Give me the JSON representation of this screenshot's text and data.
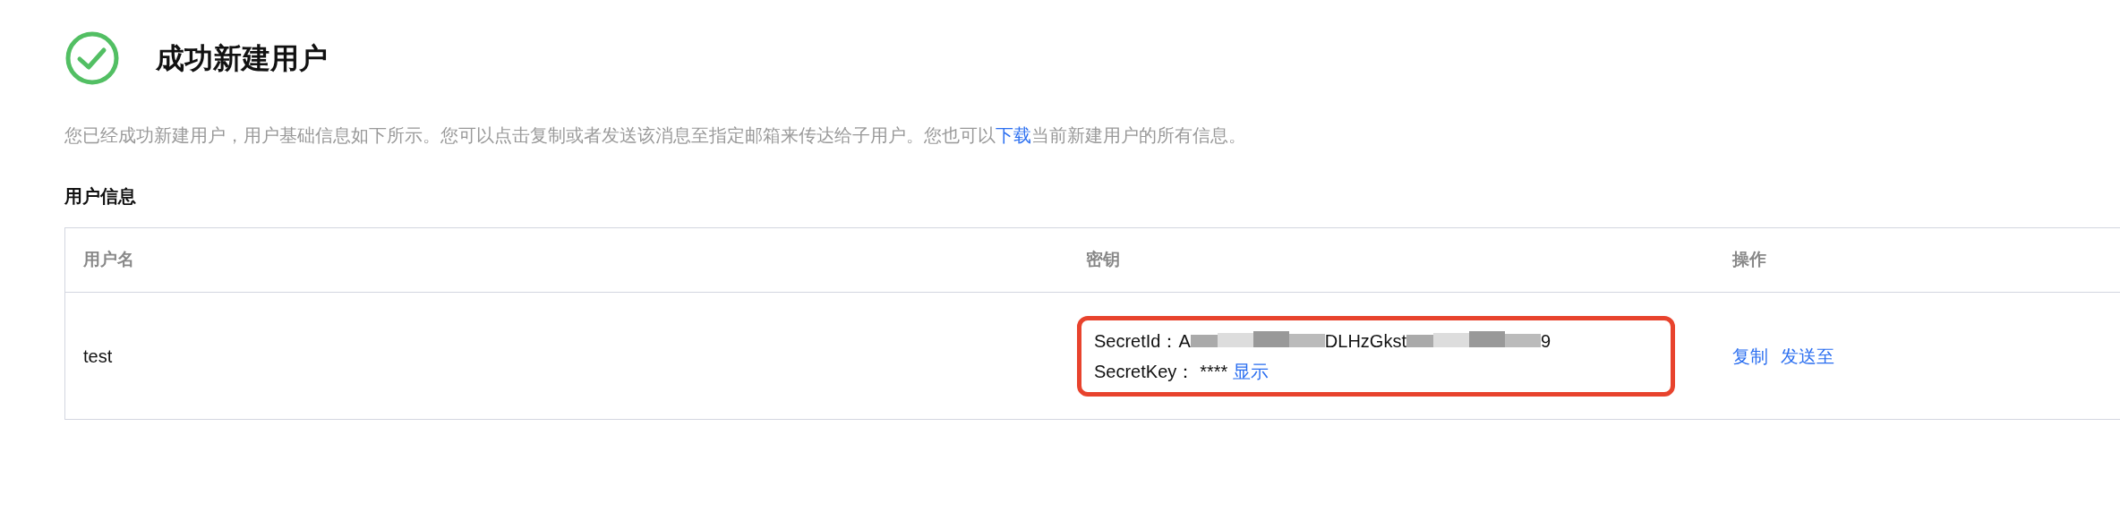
{
  "title": "成功新建用户",
  "description": "您已经成功新建用户，用户基础信息如下所示。您可以点击复制或者发送该消息至指定邮箱来传达给子用户。您也可以",
  "description_link": "下载",
  "description_end": "当前新建用户的所有信息。",
  "section_title": "用户信息",
  "table": {
    "columns": [
      "用户名",
      "密钥",
      "操作"
    ],
    "rows": [
      {
        "username": "test",
        "secret_id_label": "SecretId：",
        "secret_id_start": "A",
        "secret_id_middle": "DLHzGkst",
        "secret_id_end": "9",
        "secret_key_label": "SecretKey：",
        "secret_key_value": "****",
        "secret_key_action": "显示",
        "highlighted": true,
        "actions": [
          "复制",
          "发送至"
        ]
      }
    ]
  }
}
